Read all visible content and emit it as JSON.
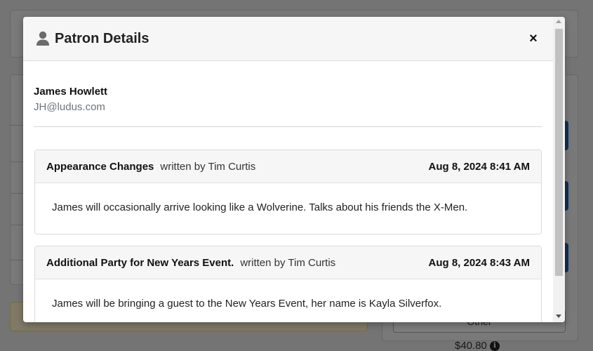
{
  "background": {
    "selector_value": "Other",
    "price": "$40.80",
    "price_icon": "info-icon"
  },
  "modal": {
    "title": "Patron Details",
    "title_icon": "person-icon",
    "close_label": "×"
  },
  "patron": {
    "name": "James Howlett",
    "email": "JH@ludus.com"
  },
  "notes": [
    {
      "title": "Appearance Changes",
      "author": "written by Tim Curtis",
      "date": "Aug 8, 2024 8:41 AM",
      "body": "James will occasionally arrive looking like a Wolverine. Talks about his friends the X-Men."
    },
    {
      "title": "Additional Party for New Years Event.",
      "author": "written by Tim Curtis",
      "date": "Aug 8, 2024 8:43 AM",
      "body": "James will be bringing a guest to the New Years Event, her name is Kayla Silverfox."
    }
  ]
}
